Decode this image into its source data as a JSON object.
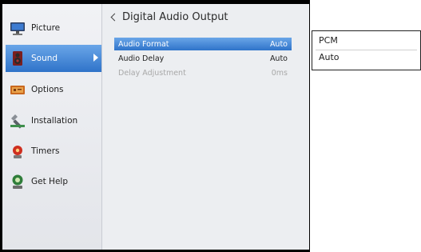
{
  "sidebar": {
    "items": [
      {
        "label": "Picture",
        "icon": "monitor-icon"
      },
      {
        "label": "Sound",
        "icon": "speaker-icon"
      },
      {
        "label": "Options",
        "icon": "options-icon"
      },
      {
        "label": "Installation",
        "icon": "installation-icon"
      },
      {
        "label": "Timers",
        "icon": "timer-icon"
      },
      {
        "label": "Get Help",
        "icon": "help-icon"
      }
    ],
    "active": "Sound"
  },
  "content": {
    "title": "Digital Audio Output",
    "rows": [
      {
        "label": "Audio Format",
        "value": "Auto",
        "state": "selected"
      },
      {
        "label": "Audio Delay",
        "value": "Auto",
        "state": "normal"
      },
      {
        "label": "Delay Adjustment",
        "value": "0ms",
        "state": "disabled"
      }
    ]
  },
  "popup": {
    "options": [
      "PCM",
      "Auto"
    ]
  },
  "colors": {
    "highlight": "#2f73c9",
    "highlight_top": "#6aa6e8"
  }
}
